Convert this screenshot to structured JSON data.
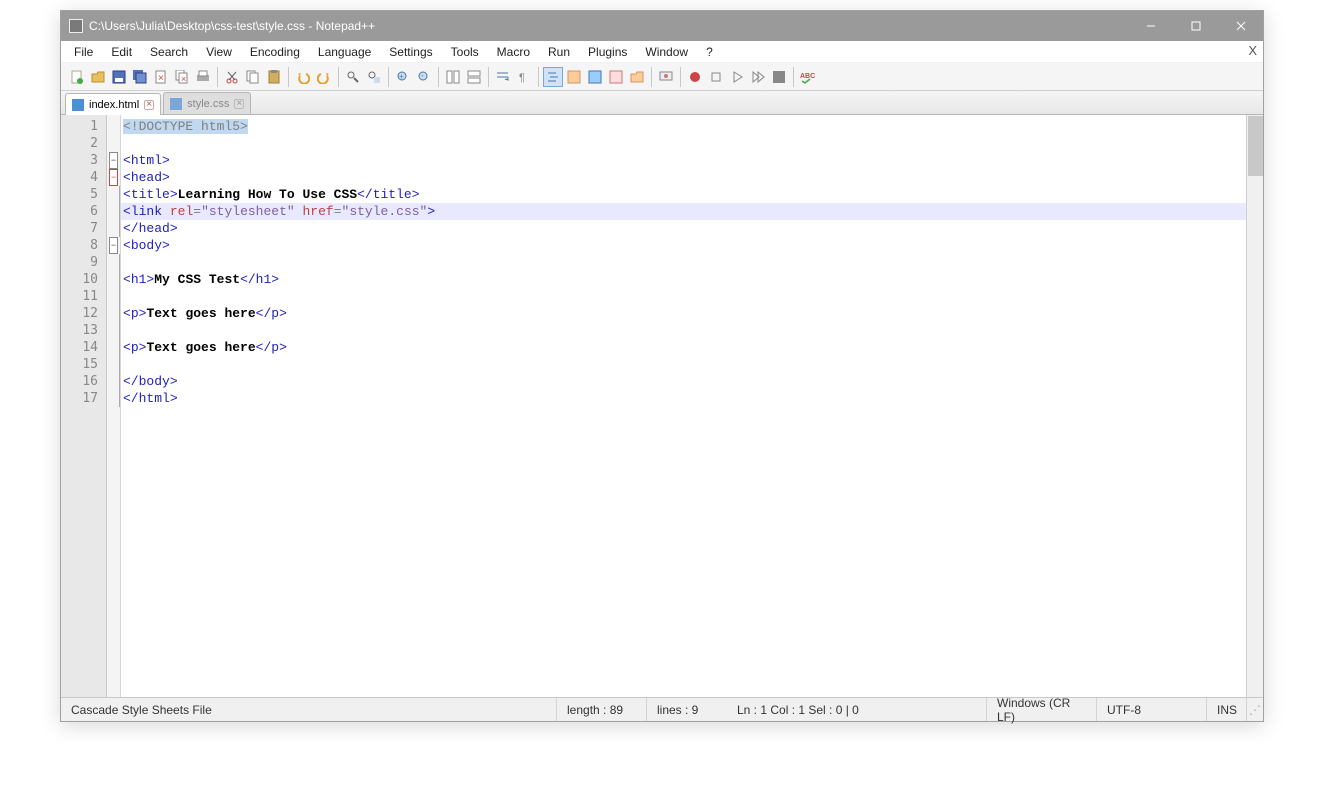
{
  "titlebar": {
    "text": "C:\\Users\\Julia\\Desktop\\css-test\\style.css - Notepad++"
  },
  "menu": {
    "items": [
      "File",
      "Edit",
      "Search",
      "View",
      "Encoding",
      "Language",
      "Settings",
      "Tools",
      "Macro",
      "Run",
      "Plugins",
      "Window",
      "?"
    ],
    "close_x": "X"
  },
  "tabs": {
    "active": {
      "label": "index.html"
    },
    "inactive": {
      "label": "style.css"
    }
  },
  "code": {
    "line_count": 17,
    "highlighted_line": 6,
    "parts": {
      "l1_doctype": "<!DOCTYPE html5>",
      "l3_open": "<",
      "l3_tag": "html",
      "l3_close": ">",
      "l4_open": "<",
      "l4_tag": "head",
      "l4_close": ">",
      "l5_open": "<",
      "l5_tag": "title",
      "l5_close": ">",
      "l5_text": "Learning How To Use CSS",
      "l5_eopen": "</",
      "l5_etag": "title",
      "l5_eclose": ">",
      "l6_open": "<",
      "l6_tag": "link",
      "l6_sp1": " ",
      "l6_a1": "rel",
      "l6_eq1": "=",
      "l6_v1": "\"stylesheet\"",
      "l6_sp2": " ",
      "l6_a2": "href",
      "l6_eq2": "=",
      "l6_v2": "\"style.css\"",
      "l6_close": ">",
      "l7_open": "</",
      "l7_tag": "head",
      "l7_close": ">",
      "l8_open": "<",
      "l8_tag": "body",
      "l8_close": ">",
      "l10_open": "<",
      "l10_tag": "h1",
      "l10_close": ">",
      "l10_text": "My CSS Test",
      "l10_eopen": "</",
      "l10_etag": "h1",
      "l10_eclose": ">",
      "l12_open": "<",
      "l12_tag": "p",
      "l12_close": ">",
      "l12_text": "Text goes here",
      "l12_eopen": "</",
      "l12_etag": "p",
      "l12_eclose": ">",
      "l14_open": "<",
      "l14_tag": "p",
      "l14_close": ">",
      "l14_text": "Text goes here",
      "l14_eopen": "</",
      "l14_etag": "p",
      "l14_eclose": ">",
      "l16_open": "</",
      "l16_tag": "body",
      "l16_close": ">",
      "l17_open": "</",
      "l17_tag": "html",
      "l17_close": ">"
    }
  },
  "statusbar": {
    "file_type": "Cascade Style Sheets File",
    "length": "length : 89",
    "lines": "lines : 9",
    "pos": "Ln : 1   Col : 1   Sel : 0 | 0",
    "eol": "Windows (CR LF)",
    "encoding": "UTF-8",
    "mode": "INS"
  }
}
